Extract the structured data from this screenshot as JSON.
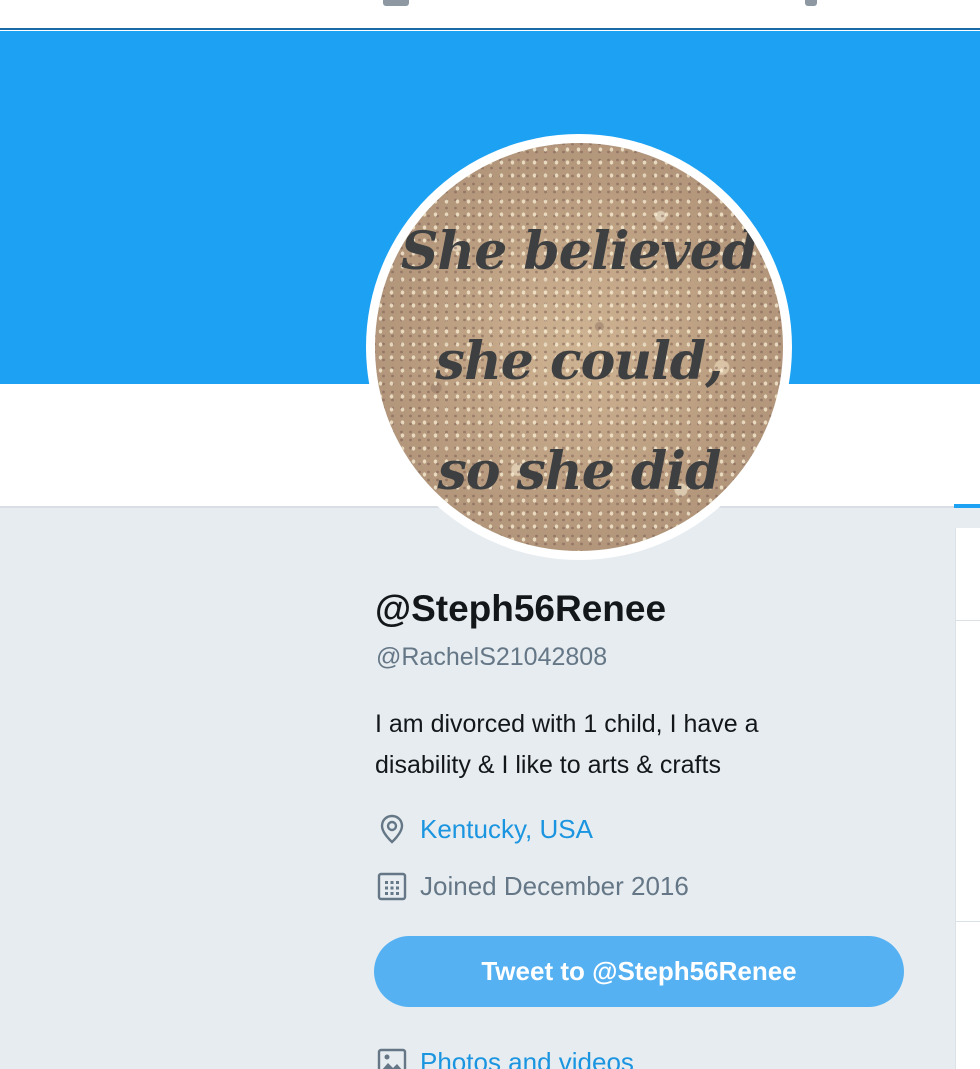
{
  "avatar": {
    "quote_lines": [
      "She believed",
      "she could,",
      "so she did"
    ]
  },
  "profile": {
    "display_name": "@Steph56Renee",
    "handle": "@RachelS21042808",
    "bio_line1": "I am divorced with 1 child, I have a",
    "bio_line2": "disability & I like to arts & crafts",
    "location": "Kentucky, USA",
    "joined": "Joined December 2016",
    "location_icon": "location-pin-icon",
    "joined_icon": "calendar-icon"
  },
  "actions": {
    "tweet_to_label": "Tweet to @Steph56Renee"
  },
  "media": {
    "photos_label": "Photos and videos",
    "photos_icon": "image-icon"
  },
  "colors": {
    "banner": "#1da1f2",
    "link": "#1b95e0",
    "button": "#55b1f2",
    "page_bg": "#e6ecf0"
  }
}
